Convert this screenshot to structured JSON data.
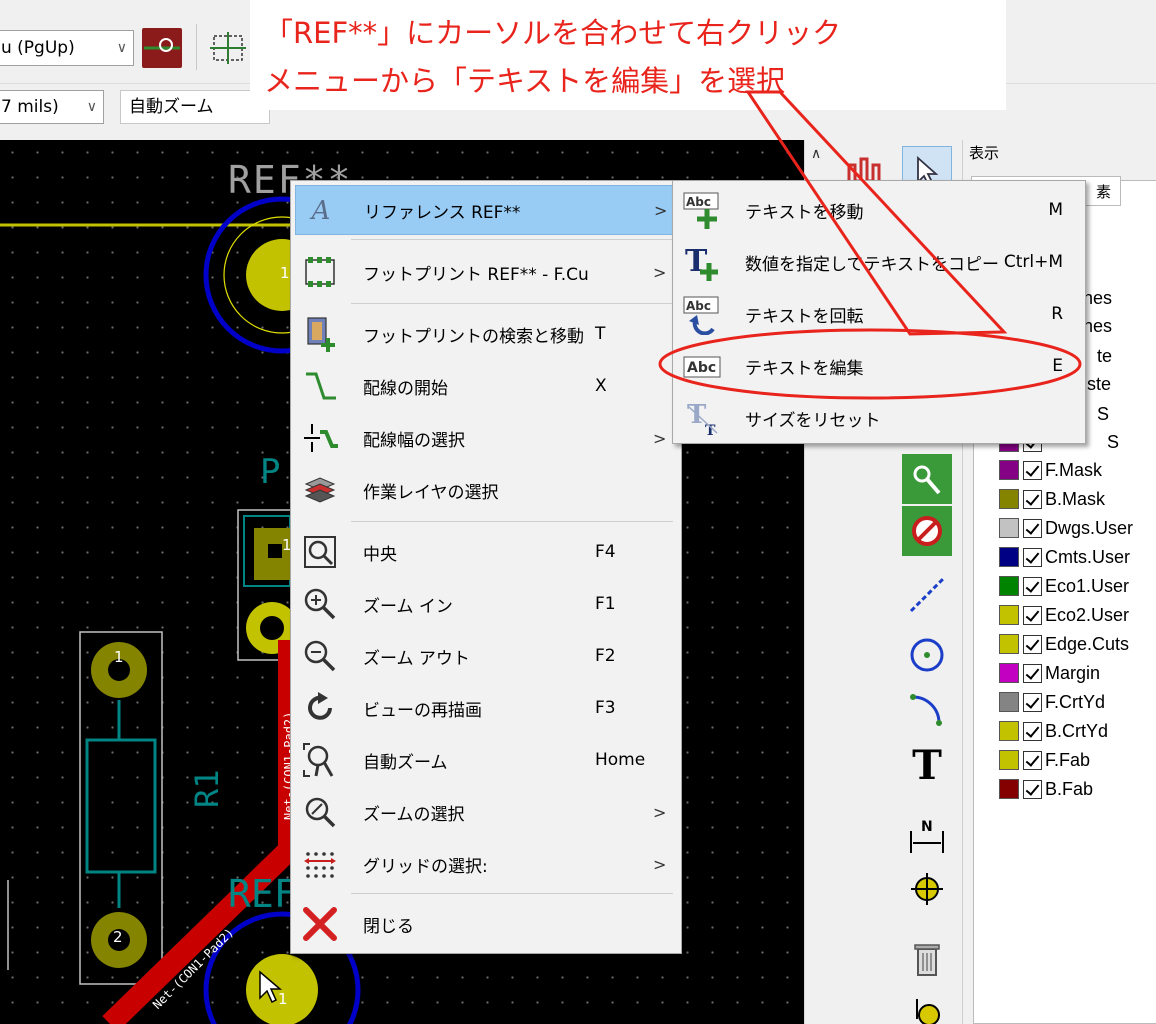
{
  "toolbar": {
    "layer_select": "u (PgUp)",
    "grid_select": "7 mils)",
    "zoom_select": "自動ズーム"
  },
  "annotation": {
    "line1": "「REF**」にカーソルを合わせて右クリック",
    "line2": "メニューから「テキストを編集」を選択"
  },
  "canvas": {
    "ref_top": "REF**",
    "ref_bottom": "REF",
    "p_label": "P",
    "r1_label": "R1",
    "pad_labels": [
      "1",
      "1",
      "1",
      "2",
      "1"
    ],
    "net_label_1": "Net-(CON1-Pad2)",
    "net_label_2": "Net-(CON1-Pad2)"
  },
  "context_menu": {
    "items": [
      {
        "label": "リファレンス REF**",
        "shortcut": "",
        "submenu": ">",
        "icon": "italic-a-icon"
      },
      {
        "label": "フットプリント REF** - F.Cu",
        "shortcut": "",
        "submenu": ">",
        "icon": "footprint-icon"
      },
      {
        "label": "フットプリントの検索と移動",
        "shortcut": "T",
        "submenu": "",
        "icon": "find-move-icon"
      },
      {
        "label": "配線の開始",
        "shortcut": "X",
        "submenu": "",
        "icon": "route-track-icon"
      },
      {
        "label": "配線幅の選択",
        "shortcut": "",
        "submenu": ">",
        "icon": "track-width-icon"
      },
      {
        "label": "作業レイヤの選択",
        "shortcut": "",
        "submenu": "",
        "icon": "layers-icon"
      },
      {
        "label": "中央",
        "shortcut": "F4",
        "submenu": "",
        "icon": "zoom-center-icon"
      },
      {
        "label": "ズーム イン",
        "shortcut": "F1",
        "submenu": "",
        "icon": "zoom-in-icon"
      },
      {
        "label": "ズーム アウト",
        "shortcut": "F2",
        "submenu": "",
        "icon": "zoom-out-icon"
      },
      {
        "label": "ビューの再描画",
        "shortcut": "F3",
        "submenu": "",
        "icon": "redraw-icon"
      },
      {
        "label": "自動ズーム",
        "shortcut": "Home",
        "submenu": "",
        "icon": "zoom-fit-icon"
      },
      {
        "label": "ズームの選択",
        "shortcut": "",
        "submenu": ">",
        "icon": "zoom-select-icon"
      },
      {
        "label": "グリッドの選択:",
        "shortcut": "",
        "submenu": ">",
        "icon": "grid-icon"
      },
      {
        "label": "閉じる",
        "shortcut": "",
        "submenu": "",
        "icon": "close-x-icon"
      }
    ]
  },
  "submenu": {
    "items": [
      {
        "label": "テキストを移動",
        "shortcut": "M",
        "icon": "text-move-icon"
      },
      {
        "label": "数値を指定してテキストをコピー",
        "shortcut": "Ctrl+M",
        "icon": "text-copy-icon"
      },
      {
        "label": "テキストを回転",
        "shortcut": "R",
        "icon": "text-rotate-icon"
      },
      {
        "label": "テキストを編集",
        "shortcut": "E",
        "icon": "text-edit-icon"
      },
      {
        "label": "サイズをリセット",
        "shortcut": "",
        "icon": "text-reset-icon"
      }
    ]
  },
  "panel": {
    "title": "表示",
    "tab_fragment": "素",
    "partial_layers": [
      "hes",
      "hes",
      "te",
      "ste",
      "S",
      "S"
    ],
    "layers": [
      {
        "name": "F.Mask",
        "color": "#840084"
      },
      {
        "name": "B.Mask",
        "color": "#848400"
      },
      {
        "name": "Dwgs.User",
        "color": "#c2c2c2"
      },
      {
        "name": "Cmts.User",
        "color": "#000084"
      },
      {
        "name": "Eco1.User",
        "color": "#008400"
      },
      {
        "name": "Eco2.User",
        "color": "#c2c200"
      },
      {
        "name": "Edge.Cuts",
        "color": "#c2c200"
      },
      {
        "name": "Margin",
        "color": "#c200c2"
      },
      {
        "name": "F.CrtYd",
        "color": "#848484"
      },
      {
        "name": "B.CrtYd",
        "color": "#c2c200"
      },
      {
        "name": "F.Fab",
        "color": "#c2c200"
      },
      {
        "name": "B.Fab",
        "color": "#840000"
      }
    ]
  },
  "colors": {
    "annotation_red": "#e8241c",
    "menu_highlight": "#99ccf5",
    "pad_yellow": "#c2c200",
    "track_red": "#c80000",
    "copper_blue": "#0000c8"
  }
}
